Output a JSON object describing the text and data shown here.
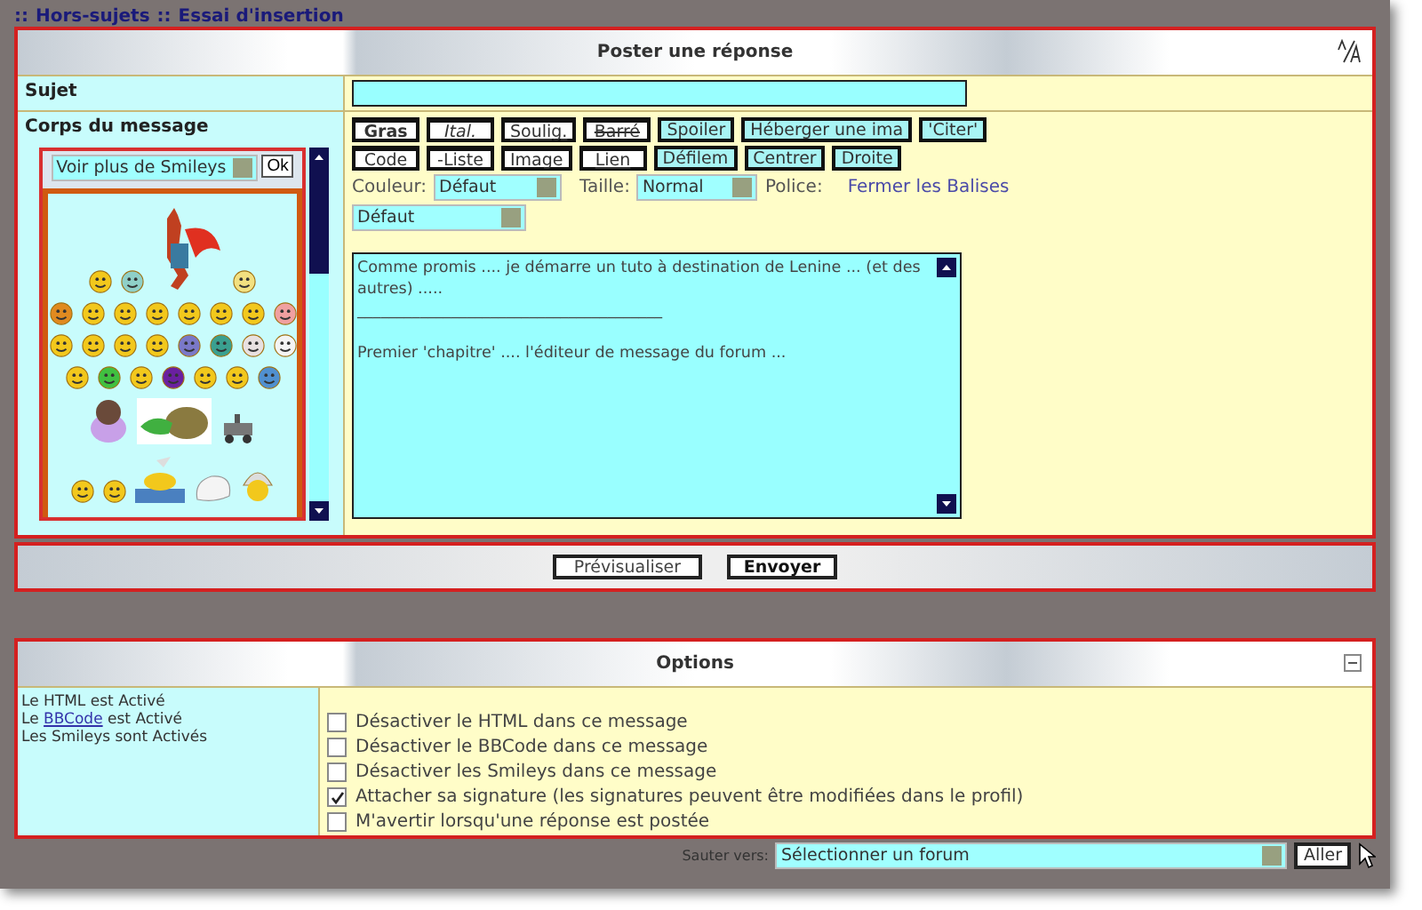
{
  "breadcrumb": {
    "separator": "::",
    "links": [
      "Hors-sujets",
      "Essai d'insertion"
    ]
  },
  "post_panel": {
    "title": "Poster une réponse",
    "subject_label": "Sujet",
    "body_label": "Corps du message"
  },
  "smileys": {
    "more_select": "Voir plus de Smileys",
    "ok_button": "Ok"
  },
  "toolbar_rows": [
    [
      {
        "label": "Gras",
        "kind": "bold"
      },
      {
        "label": "Ital.",
        "kind": "italic"
      },
      {
        "label": "Soulig.",
        "kind": "underline"
      },
      {
        "label": "Barré",
        "kind": "strike"
      },
      {
        "label": "Spoiler",
        "kind": "tag"
      },
      {
        "label": "Héberger une ima",
        "kind": "tag"
      },
      {
        "label": "'Citer'",
        "kind": "tag"
      }
    ],
    [
      {
        "label": "Code",
        "kind": "plain"
      },
      {
        "label": "-Liste",
        "kind": "plain"
      },
      {
        "label": "Image",
        "kind": "plain"
      },
      {
        "label": "Lien",
        "kind": "underline"
      },
      {
        "label": "Défilem",
        "kind": "tag"
      },
      {
        "label": "Centrer",
        "kind": "tag"
      },
      {
        "label": "Droite",
        "kind": "tag"
      }
    ]
  ],
  "format_selects": {
    "color_label": "Couleur:",
    "color_value": "Défaut",
    "size_label": "Taille:",
    "size_value": "Normal",
    "font_label": "Police:",
    "font_value": "Défaut",
    "close_tags_link": "Fermer les Balises"
  },
  "message": {
    "lines": [
      "Comme promis .... je démarre un tuto à destination de Lenine ... (et des autres) .....",
      "_______________________________________",
      "Premier 'chapitre' .... l'éditeur de message du forum ..."
    ]
  },
  "actions": [
    "Prévisualiser",
    "Envoyer"
  ],
  "options_panel": {
    "title": "Options",
    "status": [
      {
        "text": "Le HTML est Activé",
        "kind": "plain"
      },
      {
        "parts": [
          "Le ",
          "est Activé"
        ],
        "link": "BBCode",
        "kind": "link"
      },
      {
        "text": "Les Smileys sont Activés",
        "kind": "plain"
      }
    ],
    "checkboxes": [
      {
        "label": "Désactiver le HTML dans ce message",
        "checked": false
      },
      {
        "label": "Désactiver le BBCode dans ce message",
        "checked": false
      },
      {
        "label": "Désactiver les Smileys dans ce message",
        "checked": false
      },
      {
        "label": "Attacher sa signature (les signatures peuvent être modifiées dans le profil)",
        "checked": true
      },
      {
        "label": "M'avertir lorsqu'une réponse est postée",
        "checked": false
      }
    ]
  },
  "jump": {
    "label": "Sauter vers:",
    "select": "Sélectionner un forum",
    "button": "Aller"
  }
}
